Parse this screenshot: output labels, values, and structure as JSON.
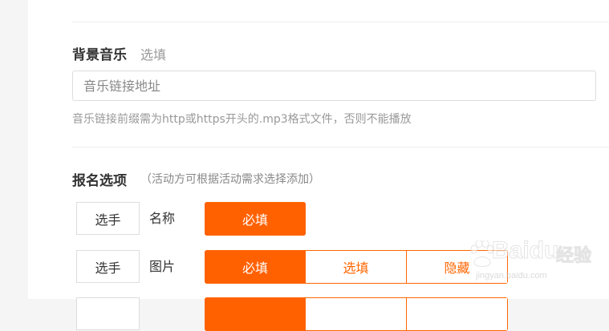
{
  "background_music": {
    "title": "背景音乐",
    "optional_tag": "选填",
    "input_placeholder": "音乐链接地址",
    "input_value": "",
    "note": "音乐链接前缀需为http或https开头的.mp3格式文件，否则不能播放"
  },
  "signup_options": {
    "title": "报名选项",
    "hint": "（活动方可根据活动需求选择添加）",
    "rows": [
      {
        "tag": "选手",
        "field": "名称",
        "options": [
          "必填"
        ],
        "selected": "必填"
      },
      {
        "tag": "选手",
        "field": "图片",
        "options": [
          "必填",
          "选填",
          "隐藏"
        ],
        "selected": "必填"
      }
    ]
  },
  "watermark": {
    "brand": "Baidu",
    "brand_cn": "经验",
    "url": "jingyan.baidu.com"
  },
  "colors": {
    "accent": "#ff6000",
    "text": "#333333",
    "muted": "#999999",
    "border": "#dddddd"
  }
}
